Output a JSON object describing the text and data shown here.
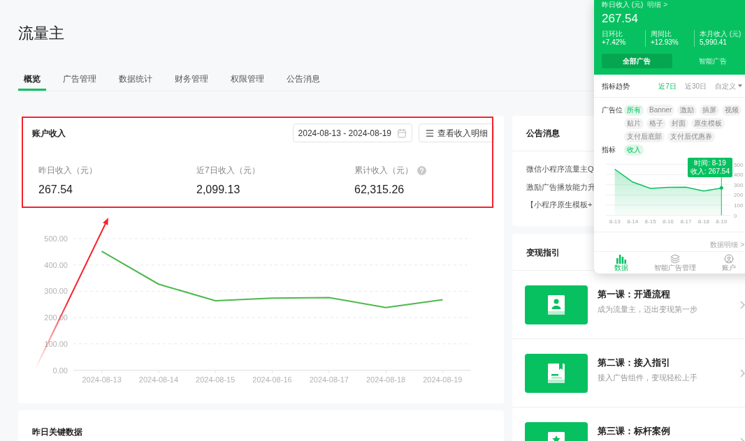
{
  "page": {
    "title": "流量主"
  },
  "tabs": [
    {
      "label": "概览",
      "selected": true
    },
    {
      "label": "广告管理",
      "selected": false
    },
    {
      "label": "数据统计",
      "selected": false
    },
    {
      "label": "财务管理",
      "selected": false
    },
    {
      "label": "权限管理",
      "selected": false
    },
    {
      "label": "公告消息",
      "selected": false
    }
  ],
  "income_card": {
    "title": "账户收入",
    "date_range": "2024-08-13 - 2024-08-19",
    "detail_button": "查看收入明细",
    "stats": [
      {
        "label": "昨日收入（元）",
        "value": "267.54",
        "has_help": false
      },
      {
        "label": "近7日收入（元）",
        "value": "2,099.13",
        "has_help": false
      },
      {
        "label": "累计收入（元）",
        "value": "62,315.26",
        "has_help": true
      }
    ],
    "chart_data": {
      "type": "line",
      "categories": [
        "2024-08-13",
        "2024-08-14",
        "2024-08-15",
        "2024-08-16",
        "2024-08-17",
        "2024-08-18",
        "2024-08-19"
      ],
      "series": [
        {
          "color": "#4cb84c",
          "values": [
            452,
            327,
            264,
            274,
            276,
            238,
            268
          ]
        }
      ],
      "ylim": [
        0,
        500
      ],
      "yticks": [
        {
          "value": 0,
          "label": "0.00"
        },
        {
          "value": 100,
          "label": "100.00"
        },
        {
          "value": 200,
          "label": "200.00"
        },
        {
          "value": 300,
          "label": "300.00"
        },
        {
          "value": 400,
          "label": "400.00"
        },
        {
          "value": 500,
          "label": "500.00"
        }
      ],
      "grid": true
    }
  },
  "key_data_card": {
    "title": "昨日关键数据"
  },
  "announcements": {
    "title": "公告消息",
    "items": [
      "微信小程序流量主Q",
      "激励广告播放能力升",
      "【小程序原生模板+"
    ]
  },
  "guide": {
    "title": "变现指引",
    "lessons": [
      {
        "title": "第一课：开通流程",
        "subtitle": "成为流量主，迈出变现第一步"
      },
      {
        "title": "第二课：接入指引",
        "subtitle": "接入广告组件，变现轻松上手"
      },
      {
        "title": "第三课：标杆案例"
      }
    ]
  },
  "mobile_panel": {
    "income_label": "昨日收入 (元)",
    "detail_link": "明细 >",
    "income_value": "267.54",
    "stats": [
      {
        "label": "日环比",
        "value": "+7.42%"
      },
      {
        "label": "周同比",
        "value": "+12.93%"
      },
      {
        "label": "本月收入 (元)",
        "value": "5,990.41"
      }
    ],
    "ad_tabs": [
      {
        "label": "全部广告",
        "selected": true
      },
      {
        "label": "智能广告",
        "selected": false
      }
    ],
    "trend_title": "指标趋势",
    "ranges": [
      {
        "label": "近7日",
        "selected": true,
        "kind": "option"
      },
      {
        "label": "近30日",
        "selected": false,
        "kind": "option"
      },
      {
        "label": "自定义",
        "selected": false,
        "kind": "dropdown"
      }
    ],
    "placement_label": "广告位",
    "placements": [
      {
        "label": "所有",
        "selected": true
      },
      {
        "label": "Banner",
        "selected": false
      },
      {
        "label": "激励",
        "selected": false
      },
      {
        "label": "插屏",
        "selected": false
      },
      {
        "label": "视频",
        "selected": false
      },
      {
        "label": "贴片",
        "selected": false
      },
      {
        "label": "格子",
        "selected": false
      },
      {
        "label": "封面",
        "selected": false
      },
      {
        "label": "原生模板",
        "selected": false
      },
      {
        "label": "支付后底部",
        "selected": false
      },
      {
        "label": "支付后优惠券",
        "selected": false
      }
    ],
    "metric_label": "指标",
    "metrics": [
      {
        "label": "收入",
        "selected": true
      }
    ],
    "chart_data": {
      "type": "area",
      "categories": [
        "8-13",
        "8-14",
        "8-15",
        "8-16",
        "8-17",
        "8-18",
        "8-19"
      ],
      "series": [
        {
          "color": "#07c160",
          "values": [
            452,
            327,
            264,
            274,
            276,
            238,
            268
          ]
        }
      ],
      "ylim": [
        0,
        500
      ],
      "yticks": [
        0,
        100,
        200,
        300,
        400,
        500
      ],
      "grid": true
    },
    "tooltip": {
      "time": "时间: 8-19",
      "value": "收入: 267.54"
    },
    "data_detail_link": "数据明细 >",
    "nav": [
      {
        "label": "数据",
        "selected": true
      },
      {
        "label": "智能广告管理",
        "selected": false
      },
      {
        "label": "账户",
        "selected": false
      }
    ]
  }
}
